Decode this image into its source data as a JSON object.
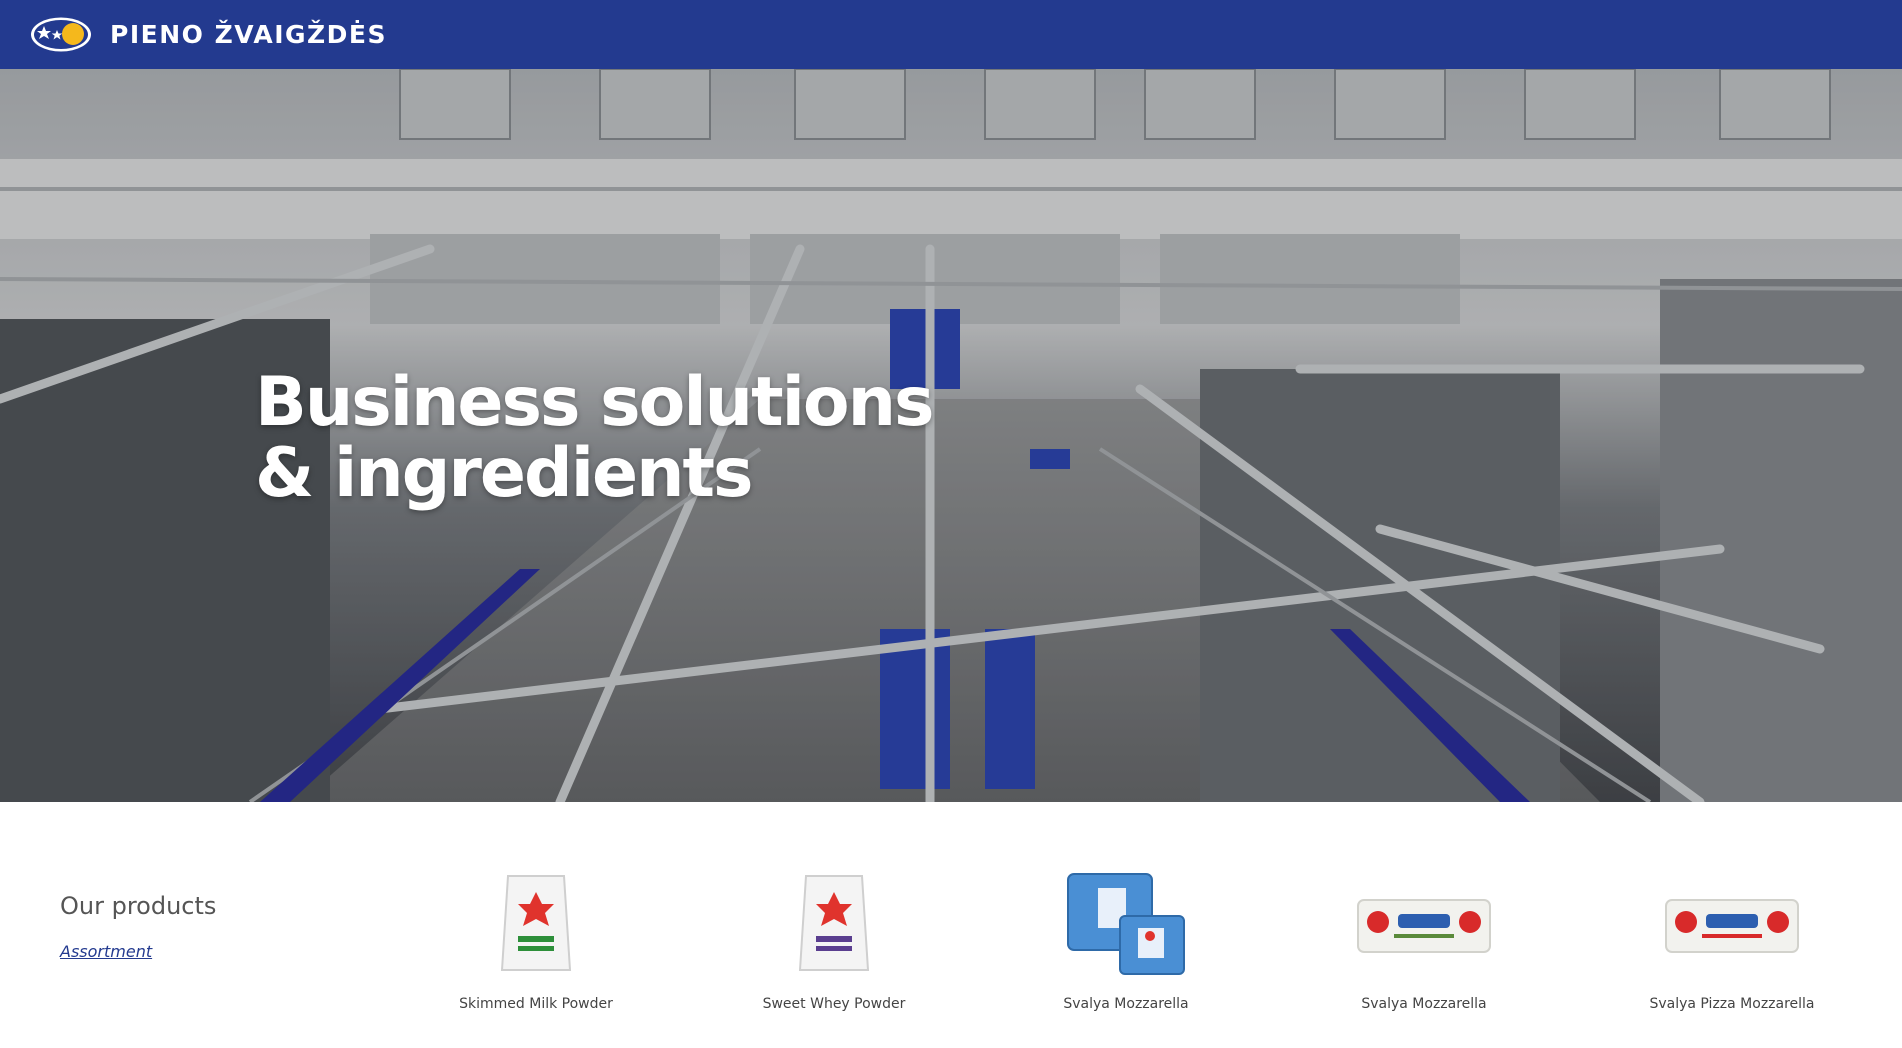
{
  "header": {
    "brand": "PIENO ŽVAIGŽDĖS",
    "logo_icon": "stars-cloud-logo-icon",
    "background_color": "#233a8f"
  },
  "hero": {
    "title_line1": "Business solutions",
    "title_line2": "& ingredients",
    "image": "dairy-factory-interior-photo"
  },
  "products": {
    "heading": "Our products",
    "assortment_link": "Assortment",
    "items": [
      {
        "name": "Skimmed Milk Powder",
        "icon": "milk-powder-bag-icon"
      },
      {
        "name": "Sweet Whey Powder",
        "icon": "whey-powder-bag-icon"
      },
      {
        "name": "Svalya Mozzarella",
        "icon": "mozzarella-pack-icon"
      },
      {
        "name": "Svalya Mozzarella",
        "icon": "mozzarella-block-icon"
      },
      {
        "name": "Svalya Pizza Mozzarella",
        "icon": "pizza-mozzarella-block-icon"
      }
    ]
  }
}
